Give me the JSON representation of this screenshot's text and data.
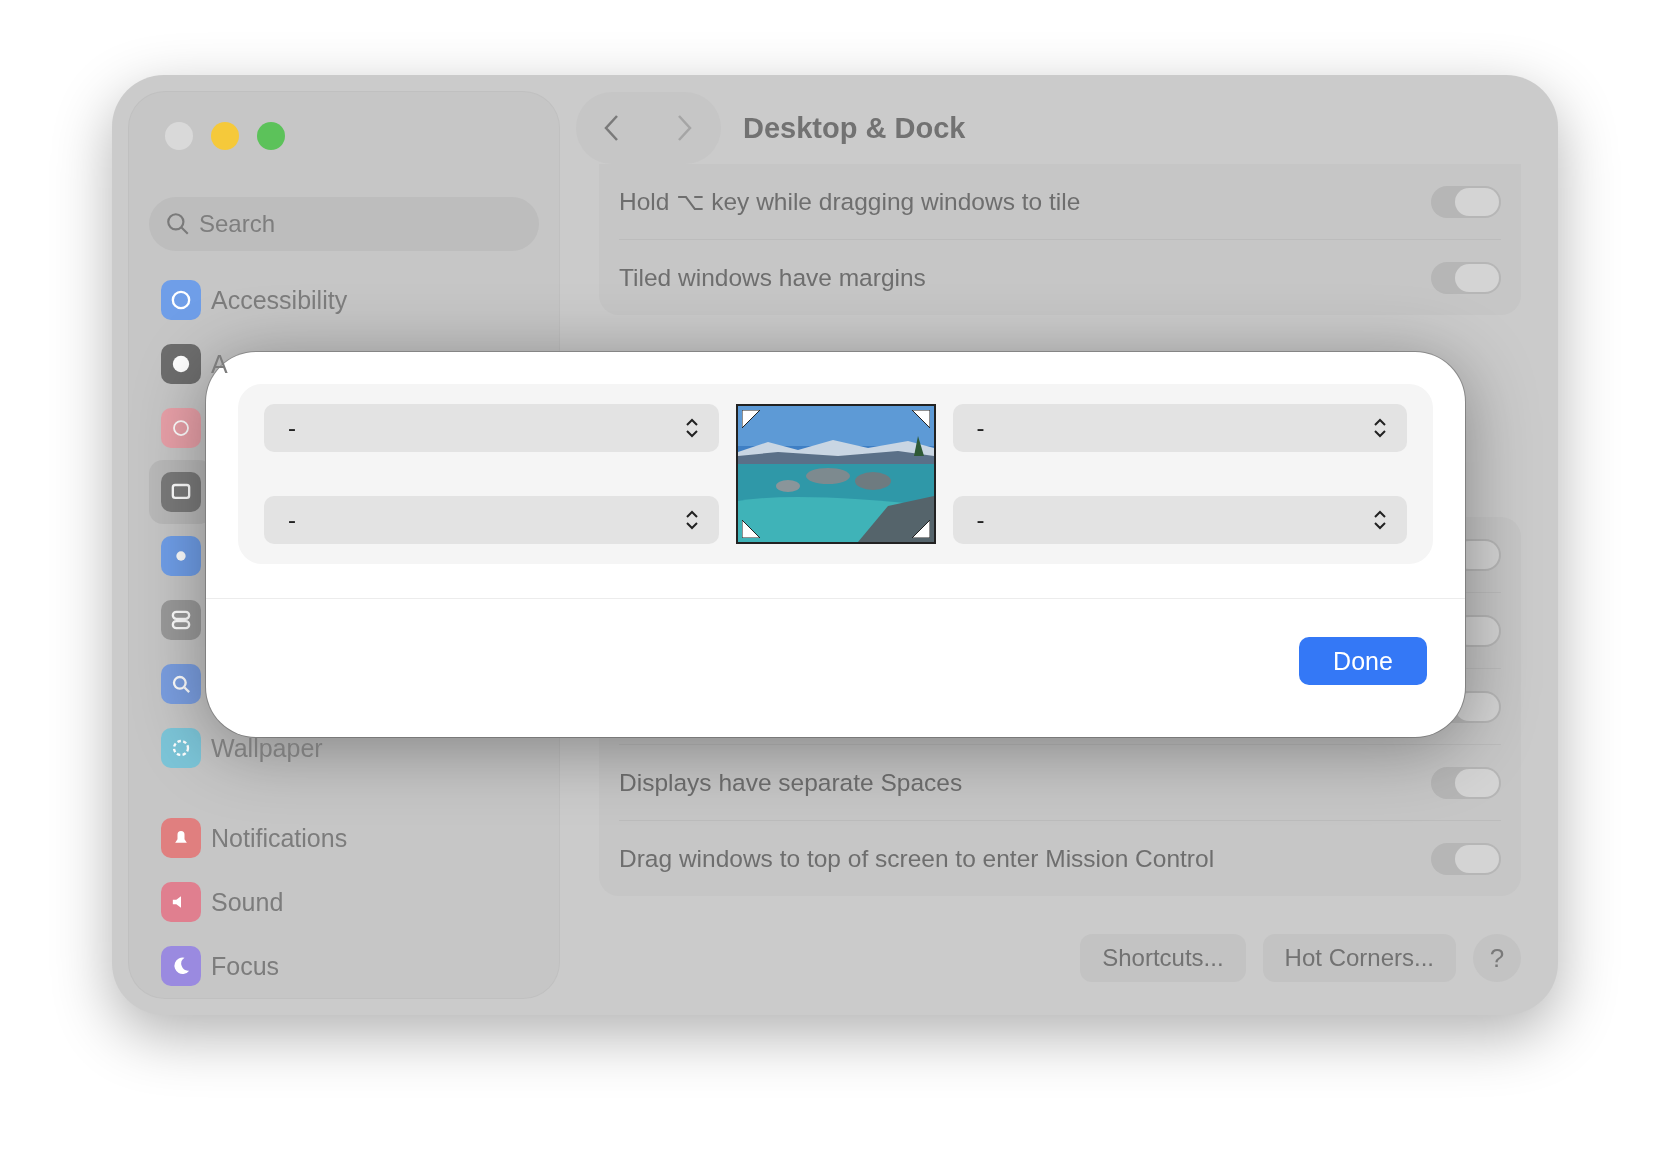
{
  "window": {
    "title": "Desktop & Dock"
  },
  "sidebar": {
    "search": {
      "placeholder": "Search"
    },
    "items": [
      {
        "label": "Accessibility",
        "color": "#6f9ee8",
        "selected": false
      },
      {
        "label": "A",
        "color": "#6d6d6d",
        "selected": false
      },
      {
        "color": "#e8a0a8",
        "selected": false
      },
      {
        "color": "#7a7a7a",
        "selected": true
      },
      {
        "color": "#6f9ee8",
        "selected": false
      },
      {
        "color": "#9a9a9a",
        "selected": false
      },
      {
        "color": "#7a9ee0",
        "selected": false
      },
      {
        "label": "Wallpaper",
        "color": "#7cc5d8",
        "selected": false
      },
      {
        "label": "Notifications",
        "color": "#e07f7f",
        "selected": false
      },
      {
        "label": "Sound",
        "color": "#e07f8f",
        "selected": false
      },
      {
        "label": "Focus",
        "color": "#9a8ae0",
        "selected": false
      }
    ]
  },
  "top_group": [
    {
      "label": "Hold ⌥ key while dragging windows to tile",
      "on": true
    },
    {
      "label": "Tiled windows have margins",
      "on": true
    }
  ],
  "bottom_group": [
    {
      "on": true
    },
    {
      "on": true
    },
    {
      "on": true
    },
    {
      "label": "Displays have separate Spaces",
      "on": true
    },
    {
      "label": "Drag windows to top of screen to enter Mission Control",
      "on": true
    }
  ],
  "buttons": [
    {
      "label": "Shortcuts..."
    },
    {
      "label": "Hot Corners..."
    }
  ],
  "help": "?",
  "dialog": {
    "corners": [
      {
        "value": "-"
      },
      {
        "value": "-"
      },
      {
        "value": "-"
      },
      {
        "value": "-"
      }
    ],
    "done": "Done"
  }
}
